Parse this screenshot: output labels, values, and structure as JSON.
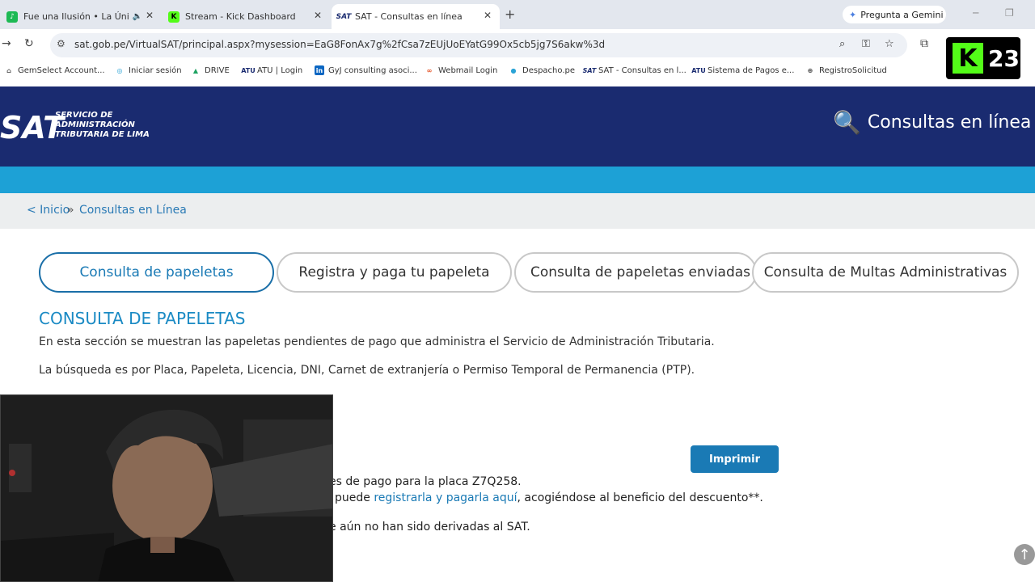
{
  "browser": {
    "tabs": [
      {
        "title": "Fue una Ilusión • La Única T",
        "has_audio": true
      },
      {
        "title": "Stream - Kick Dashboard"
      },
      {
        "title": "SAT - Consultas en línea",
        "active": true
      }
    ],
    "new_tab": "+",
    "gemini_label": "Pregunta a Gemini",
    "url": "sat.gob.pe/VirtualSAT/principal.aspx?mysession=EaG8FonAx7g%2fCsa7zEUjUoEYatG99Ox5cb5jg7S6akw%3d",
    "bookmarks": [
      "GemSelect Account...",
      "Iniciar sesión",
      "DRIVE",
      "ATU | Login",
      "GyJ consulting asoci...",
      "Webmail Login",
      "Despacho.pe",
      "SAT - Consultas en l...",
      "Sistema de Pagos e...",
      "RegistroSolicitud"
    ]
  },
  "overlay": {
    "kick_badge": "23"
  },
  "header": {
    "logo_text": "SAT",
    "logo_sub": [
      "SERVICIO DE",
      "ADMINISTRACIÓN",
      "TRIBUTARIA DE LIMA"
    ],
    "right_title": "Consultas en línea"
  },
  "breadcrumb": {
    "inicio": "< Inicio",
    "sep": "»",
    "current": "Consultas en Línea"
  },
  "tabs": [
    {
      "label": "Consulta de papeletas",
      "active": true
    },
    {
      "label": "Registra y paga tu papeleta"
    },
    {
      "label": "Consulta de papeletas enviadas a"
    },
    {
      "label": "Consulta de Multas Administrativas"
    }
  ],
  "section": {
    "title": "CONSULTA DE PAPELETAS",
    "para1": "En esta sección se muestran las papeletas pendientes de pago que administra el Servicio de Administración Tributaria.",
    "para2": "La búsqueda es por Placa, Papeleta, Licencia, DNI, Carnet de extranjería o Permiso Temporal de Permanencia (PTP)."
  },
  "print_button": "Imprimir",
  "results": {
    "line1": "es de pago para la placa Z7Q258.",
    "line2_prefix": "puede ",
    "line2_link": "registrarla y pagarla aquí",
    "line2_suffix": ", acogiéndose al beneficio del descuento**.",
    "line3": "e aún no han sido derivadas al SAT."
  }
}
